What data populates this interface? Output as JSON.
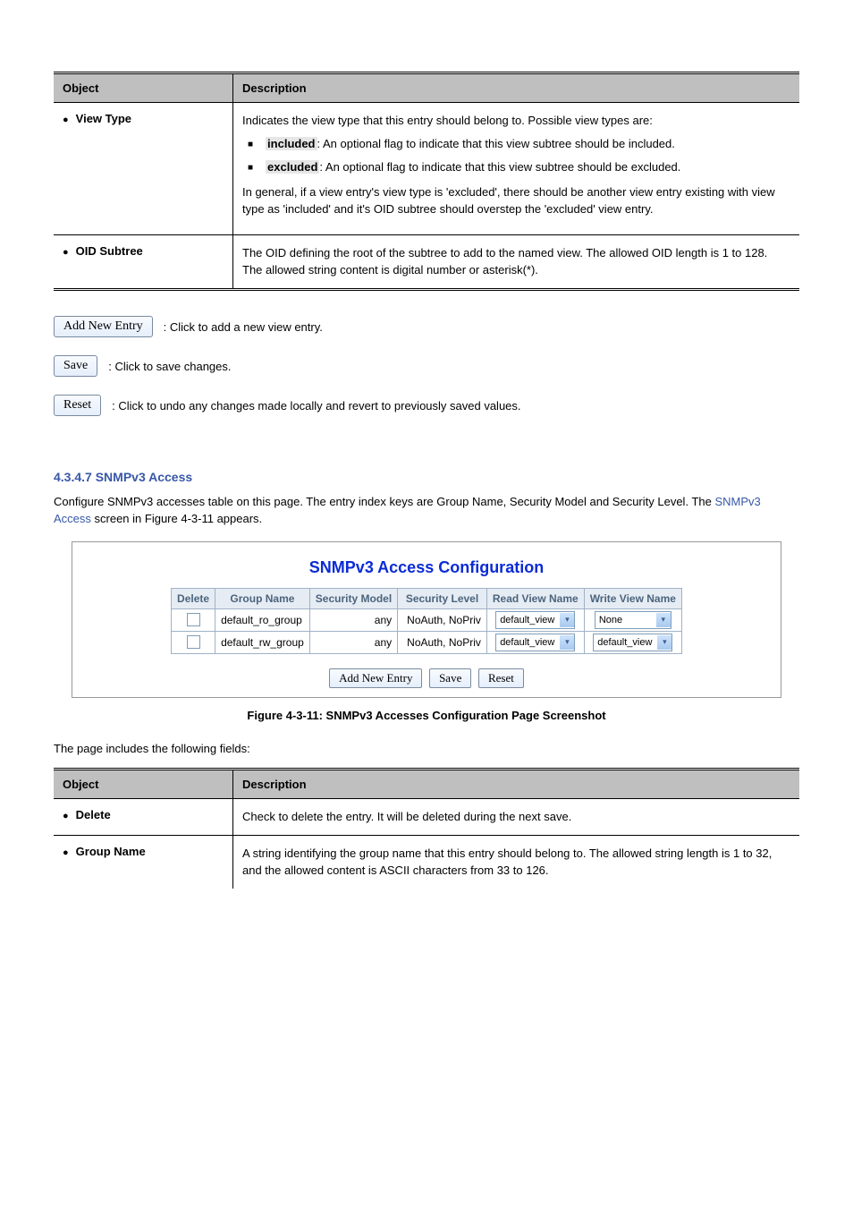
{
  "top_table": {
    "headers": {
      "object": "Object",
      "description": "Description"
    },
    "rows": [
      {
        "object": "View Type",
        "intro": "Indicates the view type that this entry should belong to. Possible view types are:",
        "options": [
          {
            "label": "included",
            "text": ": An optional flag to indicate that this view subtree should be included."
          },
          {
            "label": "excluded",
            "text": ": An optional flag to indicate that this view subtree should be excluded."
          }
        ],
        "note": "In general, if a view entry's view type is 'excluded', there should be another view entry existing with view type as 'included' and it's OID subtree should overstep the 'excluded' view entry."
      },
      {
        "object": "OID Subtree",
        "desc": "The OID defining the root of the subtree to add to the named view. The allowed OID length is 1 to 128. The allowed string content is digital number or asterisk(*)."
      }
    ]
  },
  "buttons": {
    "add_new_entry": {
      "label": "Add New Entry",
      "desc_prefix": ": Click to add a new view entry. ",
      "desc_suffix": ""
    },
    "save": {
      "label": "Save",
      "desc": ": Click to save changes."
    },
    "reset": {
      "label": "Reset",
      "desc": ": Click to undo any changes made locally and revert to previously saved values."
    }
  },
  "section": {
    "heading": "4.3.4.7 SNMPv3 Access",
    "intro_prefix": "Configure SNMPv3 accesses table on this page. The entry index keys are Group Name, Security Model and Security Level. The ",
    "intro_link": "SNMPv3 Access",
    "intro_suffix": " screen in Figure 4-3-11 appears."
  },
  "panel": {
    "title": "SNMPv3 Access Configuration",
    "columns": [
      "Delete",
      "Group Name",
      "Security Model",
      "Security Level",
      "Read View Name",
      "Write View Name"
    ],
    "rows": [
      {
        "group_name": "default_ro_group",
        "sec_model": "any",
        "sec_level": "NoAuth, NoPriv",
        "read_view": "default_view",
        "write_view": "None"
      },
      {
        "group_name": "default_rw_group",
        "sec_model": "any",
        "sec_level": "NoAuth, NoPriv",
        "read_view": "default_view",
        "write_view": "default_view"
      }
    ],
    "buttons": {
      "add": "Add New Entry",
      "save": "Save",
      "reset": "Reset"
    }
  },
  "figure_caption": "Figure 4-3-11: SNMPv3 Accesses Configuration Page Screenshot",
  "page_desc": "The page includes the following fields:",
  "bottom_table": {
    "headers": {
      "object": "Object",
      "description": "Description"
    },
    "rows": [
      {
        "object": "Delete",
        "desc": "Check to delete the entry. It will be deleted during the next save."
      },
      {
        "object": "Group Name",
        "desc": "A string identifying the group name that this entry should belong to. The allowed string length is 1 to 32, and the allowed content is ASCII characters from 33 to 126."
      }
    ]
  }
}
